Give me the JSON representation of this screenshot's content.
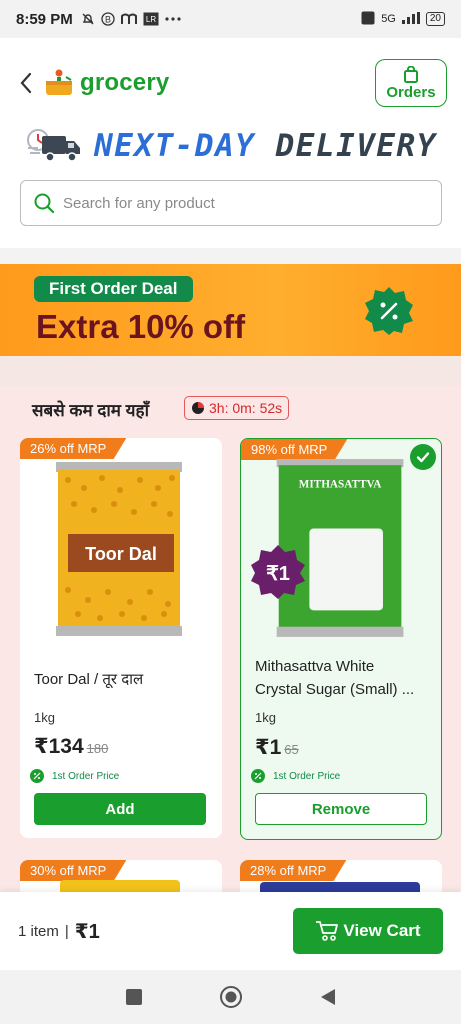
{
  "status_bar": {
    "time": "8:59 PM",
    "network": "5G",
    "battery": "20"
  },
  "header": {
    "back_icon": "chevron-left-icon",
    "logo_text": "grocery",
    "orders_label": "Orders"
  },
  "delivery": {
    "word1": "NEXT-DAY",
    "word2": "DELIVERY"
  },
  "search": {
    "placeholder": "Search for any product"
  },
  "banner": {
    "pill": "First Order Deal",
    "headline": "Extra 10% off"
  },
  "deals": {
    "title": "सबसे कम दाम यहाँ",
    "timer": "3h: 0m: 52s",
    "products": [
      {
        "tag": "26% off MRP",
        "pack_label": "Toor Dal",
        "name": "Toor Dal / तूर दाल",
        "name2": "",
        "qty": "1kg",
        "price": "₹134",
        "mrp": "180",
        "first_price": "1st Order Price",
        "action": "Add",
        "selected": false
      },
      {
        "tag": "98% off MRP",
        "pack_label": "MITHASATTVA",
        "name": "Mithasattva White",
        "name2": "Crystal Sugar (Small) ...",
        "qty": "1kg",
        "price": "₹1",
        "mrp": "65",
        "first_price": "1st Order Price",
        "action": "Remove",
        "selected": true,
        "badge": "₹1"
      },
      {
        "tag": "30% off MRP"
      },
      {
        "tag": "28% off MRP"
      }
    ]
  },
  "cart": {
    "items": "1 item",
    "separator": "|",
    "total": "₹1",
    "button": "View Cart"
  },
  "colors": {
    "brand_green": "#1a9e2e",
    "banner_orange": "#ffa424",
    "tag_orange": "#f07c1b",
    "delivery_blue": "#2c6ed8"
  }
}
